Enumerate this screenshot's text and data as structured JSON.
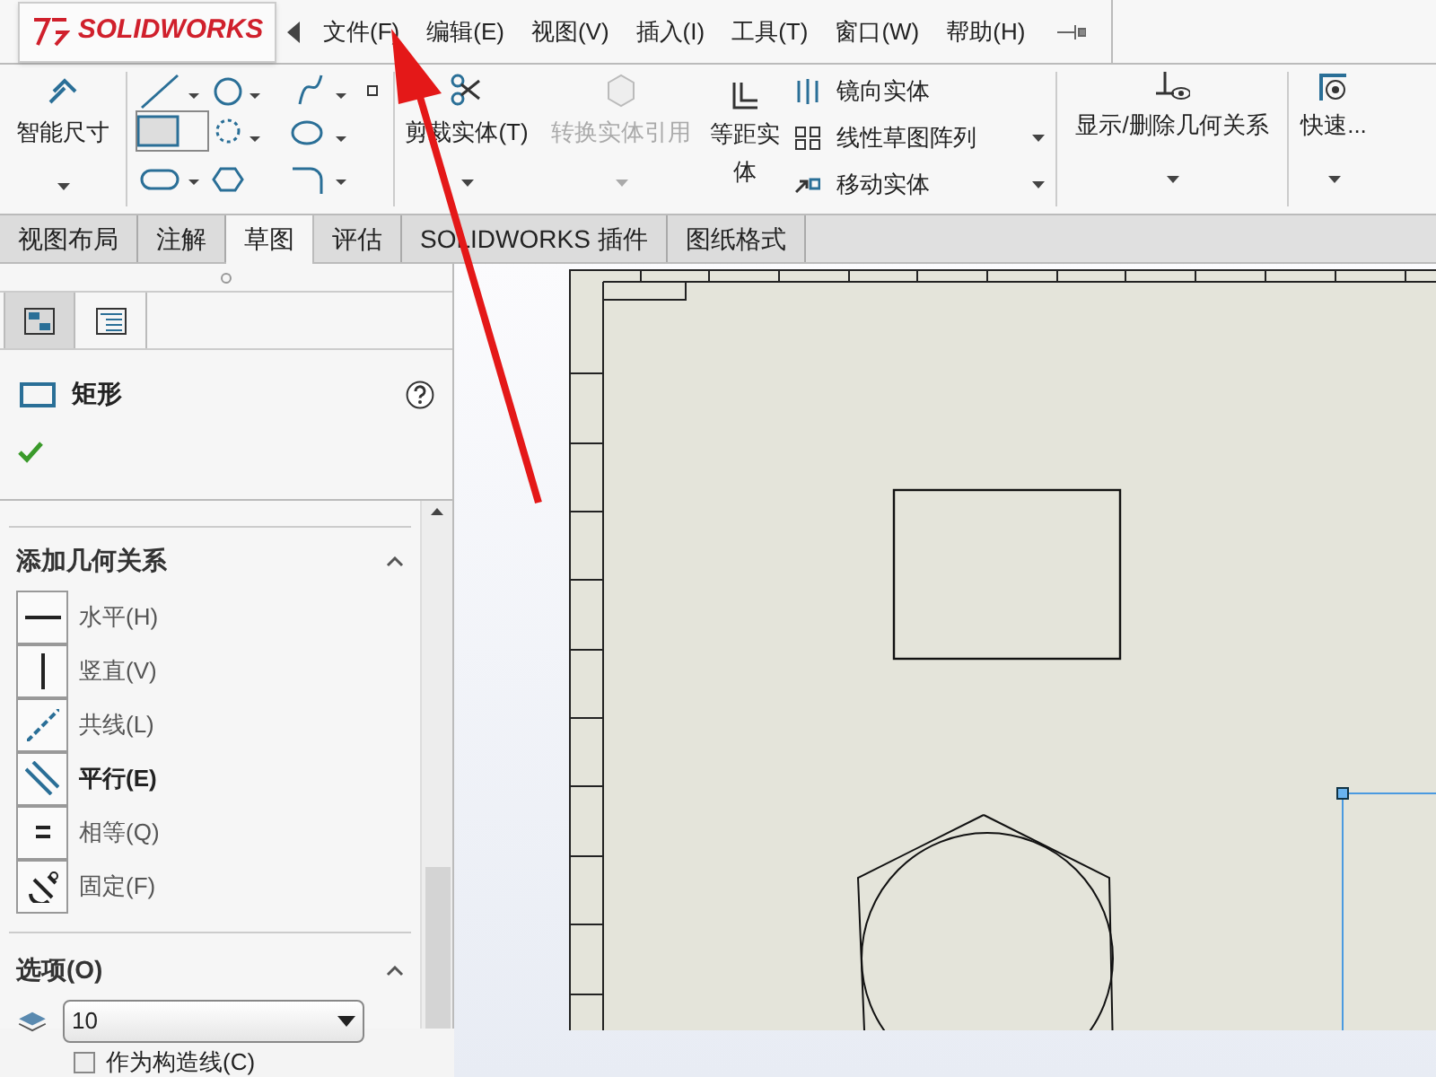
{
  "app": {
    "logo": "SOLIDWORKS"
  },
  "menu": [
    {
      "label": "文件(F)"
    },
    {
      "label": "编辑(E)"
    },
    {
      "label": "视图(V)"
    },
    {
      "label": "插入(I)"
    },
    {
      "label": "工具(T)"
    },
    {
      "label": "窗口(W)"
    },
    {
      "label": "帮助(H)"
    }
  ],
  "ribbon": {
    "smart_dimension": "智能尺寸",
    "trim": {
      "label": "剪裁实体(T)",
      "disabled": false
    },
    "convert": {
      "label": "转换实体引用",
      "disabled": true
    },
    "offset": "等距实体",
    "stack": [
      {
        "label": "镜向实体",
        "dropdown": false
      },
      {
        "label": "线性草图阵列",
        "dropdown": true
      },
      {
        "label": "移动实体",
        "dropdown": true
      }
    ],
    "relations": "显示/删除几何关系",
    "quick": "快速..."
  },
  "tabs": [
    {
      "label": "视图布局",
      "selected": false
    },
    {
      "label": "注解",
      "selected": false
    },
    {
      "label": "草图",
      "selected": true
    },
    {
      "label": "评估",
      "selected": false
    },
    {
      "label": "SOLIDWORKS 插件",
      "selected": false
    },
    {
      "label": "图纸格式",
      "selected": false
    }
  ],
  "panel": {
    "title": "矩形",
    "relations_title": "添加几何关系",
    "relations": [
      {
        "kind": "horizontal",
        "label": "水平(H)",
        "emphasized": false
      },
      {
        "kind": "vertical",
        "label": "竖直(V)",
        "emphasized": false
      },
      {
        "kind": "collinear",
        "label": "共线(L)",
        "emphasized": false
      },
      {
        "kind": "parallel",
        "label": "平行(E)",
        "emphasized": true
      },
      {
        "kind": "equal",
        "label": "相等(Q)",
        "emphasized": false
      },
      {
        "kind": "fix",
        "label": "固定(F)",
        "emphasized": false
      }
    ],
    "options_title": "选项(O)",
    "layer": "10",
    "construction": {
      "label": "作为构造线(C)",
      "checked": false
    }
  }
}
